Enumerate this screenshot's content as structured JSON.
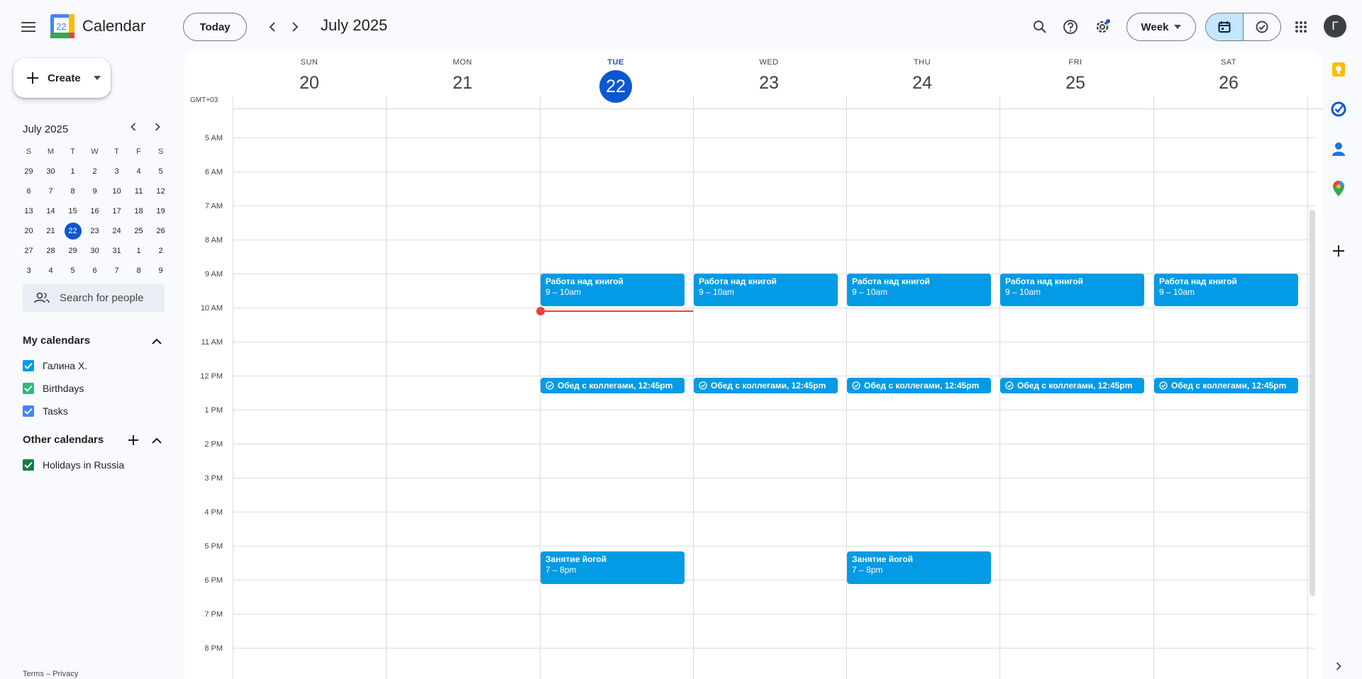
{
  "app": {
    "title": "Calendar",
    "logo_day": "22"
  },
  "header": {
    "today_label": "Today",
    "month_title": "July 2025",
    "view_select": "Week",
    "avatar_letter": "Г"
  },
  "sidebar": {
    "create_label": "Create",
    "mini_month": "July 2025",
    "weekdays": [
      "S",
      "M",
      "T",
      "W",
      "T",
      "F",
      "S"
    ],
    "weeks": [
      [
        "29",
        "30",
        "1",
        "2",
        "3",
        "4",
        "5"
      ],
      [
        "6",
        "7",
        "8",
        "9",
        "10",
        "11",
        "12"
      ],
      [
        "13",
        "14",
        "15",
        "16",
        "17",
        "18",
        "19"
      ],
      [
        "20",
        "21",
        "22",
        "23",
        "24",
        "25",
        "26"
      ],
      [
        "27",
        "28",
        "29",
        "30",
        "31",
        "1",
        "2"
      ],
      [
        "3",
        "4",
        "5",
        "6",
        "7",
        "8",
        "9"
      ]
    ],
    "search_people_placeholder": "Search for people",
    "my_calendars_title": "My calendars",
    "my_calendars": [
      {
        "name": "Галина Х.",
        "color": "#039be5"
      },
      {
        "name": "Birthdays",
        "color": "#33b679"
      },
      {
        "name": "Tasks",
        "color": "#4285f4"
      }
    ],
    "other_calendars_title": "Other calendars",
    "other_calendars": [
      {
        "name": "Holidays in Russia",
        "color": "#0b8043"
      }
    ],
    "footer": "Terms – Privacy"
  },
  "week": {
    "timezone": "GMT+03",
    "days": [
      {
        "name": "SUN",
        "num": "20"
      },
      {
        "name": "MON",
        "num": "21"
      },
      {
        "name": "TUE",
        "num": "22"
      },
      {
        "name": "WED",
        "num": "23"
      },
      {
        "name": "THU",
        "num": "24"
      },
      {
        "name": "FRI",
        "num": "25"
      },
      {
        "name": "SAT",
        "num": "26"
      }
    ],
    "hours": [
      "5 AM",
      "6 AM",
      "7 AM",
      "8 AM",
      "9 AM",
      "10 AM",
      "11 AM",
      "12 PM",
      "1 PM",
      "2 PM",
      "3 PM",
      "4 PM",
      "5 PM",
      "6 PM",
      "7 PM",
      "8 PM"
    ],
    "events": {
      "book": {
        "title": "Работа над книгой",
        "time": "9 – 10am"
      },
      "lunch": {
        "title": "Обед с коллегами, 12:45pm"
      },
      "yoga": {
        "title": "Занятие йогой",
        "time": "7 – 8pm"
      }
    }
  },
  "colors": {
    "event": "#039be5",
    "accent": "#0b57d0",
    "now_line": "#ea4335"
  }
}
